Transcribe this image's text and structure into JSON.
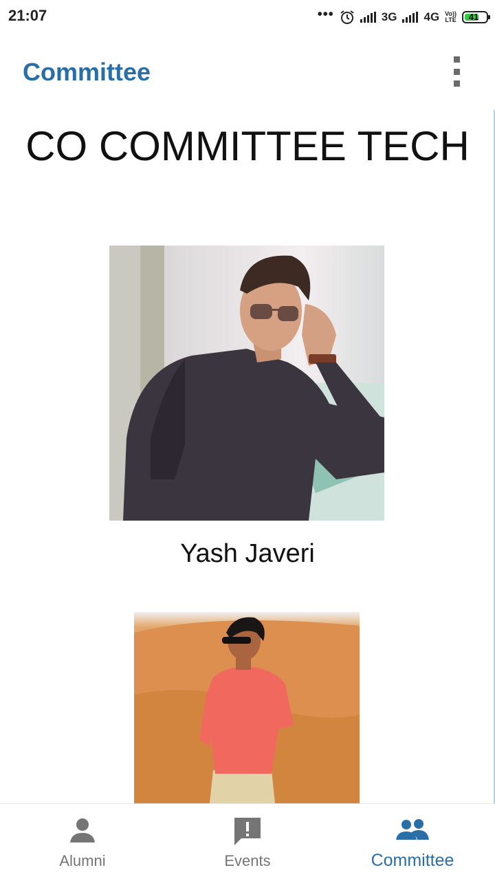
{
  "status_bar": {
    "time": "21:07",
    "dots": "•••",
    "network_1": "3G",
    "network_2": "4G",
    "volte_top": "Vo))",
    "volte_bottom": "LTE",
    "battery": "41"
  },
  "app_bar": {
    "title": "Committee",
    "menu_icon": "more-vert-icon"
  },
  "content": {
    "heading": "CO COMMITTEE TECH",
    "members": [
      {
        "name": "Yash Javeri"
      },
      {
        "name": ""
      }
    ]
  },
  "bottom_nav": {
    "items": [
      {
        "label": "Alumni",
        "icon": "person-icon",
        "active": false
      },
      {
        "label": "Events",
        "icon": "alert-chat-icon",
        "active": false
      },
      {
        "label": "Committee",
        "icon": "group-icon",
        "active": true
      }
    ]
  },
  "colors": {
    "accent": "#2a6ea7",
    "inactive": "#757575"
  }
}
